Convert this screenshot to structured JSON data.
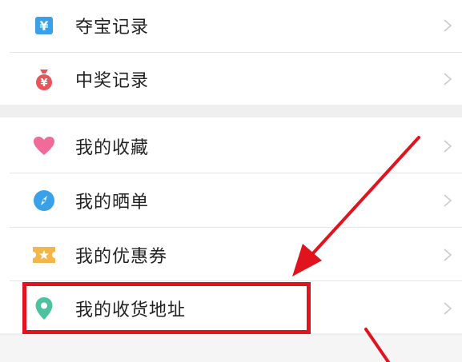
{
  "menu": {
    "items": [
      {
        "label": "夺宝记录",
        "icon": "yen-document-icon",
        "color": "#3aa0e8"
      },
      {
        "label": "中奖记录",
        "icon": "money-bag-icon",
        "color": "#e8545a"
      },
      {
        "label": "我的收藏",
        "icon": "heart-icon",
        "color": "#f06a9a"
      },
      {
        "label": "我的晒单",
        "icon": "compass-icon",
        "color": "#3aa0e8"
      },
      {
        "label": "我的优惠券",
        "icon": "coupon-icon",
        "color": "#f4b64a"
      },
      {
        "label": "我的收货地址",
        "icon": "location-pin-icon",
        "color": "#4cc2a0"
      }
    ]
  },
  "annotation": {
    "highlight_color": "#e0141e",
    "highlighted_item": "我的收货地址"
  }
}
